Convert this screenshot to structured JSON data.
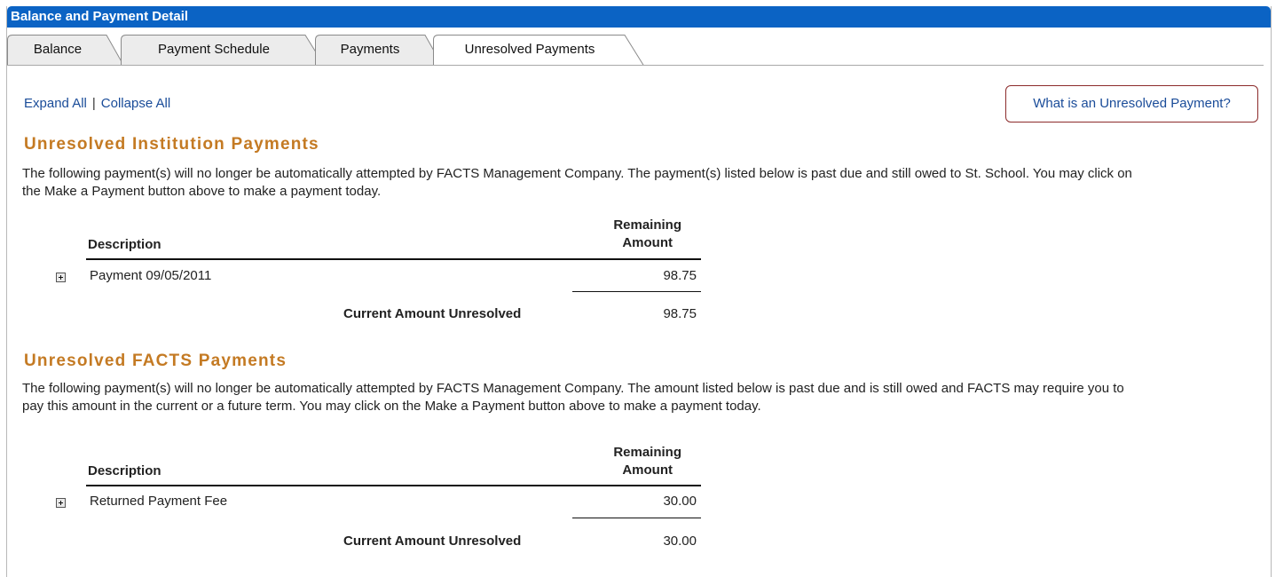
{
  "panel": {
    "title": "Balance and Payment Detail"
  },
  "tabs": [
    {
      "label": "Balance",
      "active": false
    },
    {
      "label": "Payment Schedule",
      "active": false
    },
    {
      "label": "Payments",
      "active": false
    },
    {
      "label": "Unresolved Payments",
      "active": true
    }
  ],
  "links": {
    "expand_all": "Expand All",
    "separator": "|",
    "collapse_all": "Collapse All"
  },
  "help_button": {
    "label": "What is an Unresolved Payment?"
  },
  "sections": [
    {
      "title": "Unresolved Institution Payments",
      "description": "The following payment(s) will no longer be automatically attempted by FACTS Management Company. The payment(s) listed below is past due and still owed to St. School. You may click on the Make a Payment button above to make a payment today.",
      "col_description": "Description",
      "col_amount_line1": "Remaining",
      "col_amount_line2": "Amount",
      "rows": [
        {
          "description": "Payment 09/05/2011",
          "amount": "98.75"
        }
      ],
      "total_label": "Current Amount Unresolved",
      "total_amount": "98.75"
    },
    {
      "title": "Unresolved FACTS Payments",
      "description": "The following payment(s) will no longer be automatically attempted by FACTS Management Company. The amount listed below is past due and is still owed and FACTS may require you to pay this amount in the current or a future term. You may click on the Make a Payment button above to make a payment today.",
      "col_description": "Description",
      "col_amount_line1": "Remaining",
      "col_amount_line2": "Amount",
      "rows": [
        {
          "description": "Returned Payment Fee",
          "amount": "30.00"
        }
      ],
      "total_label": "Current Amount Unresolved",
      "total_amount": "30.00"
    }
  ],
  "colors": {
    "header_bg": "#0b63c4",
    "section_title": "#c47a23",
    "link": "#1a4c99",
    "help_border": "#8c2b2b"
  }
}
